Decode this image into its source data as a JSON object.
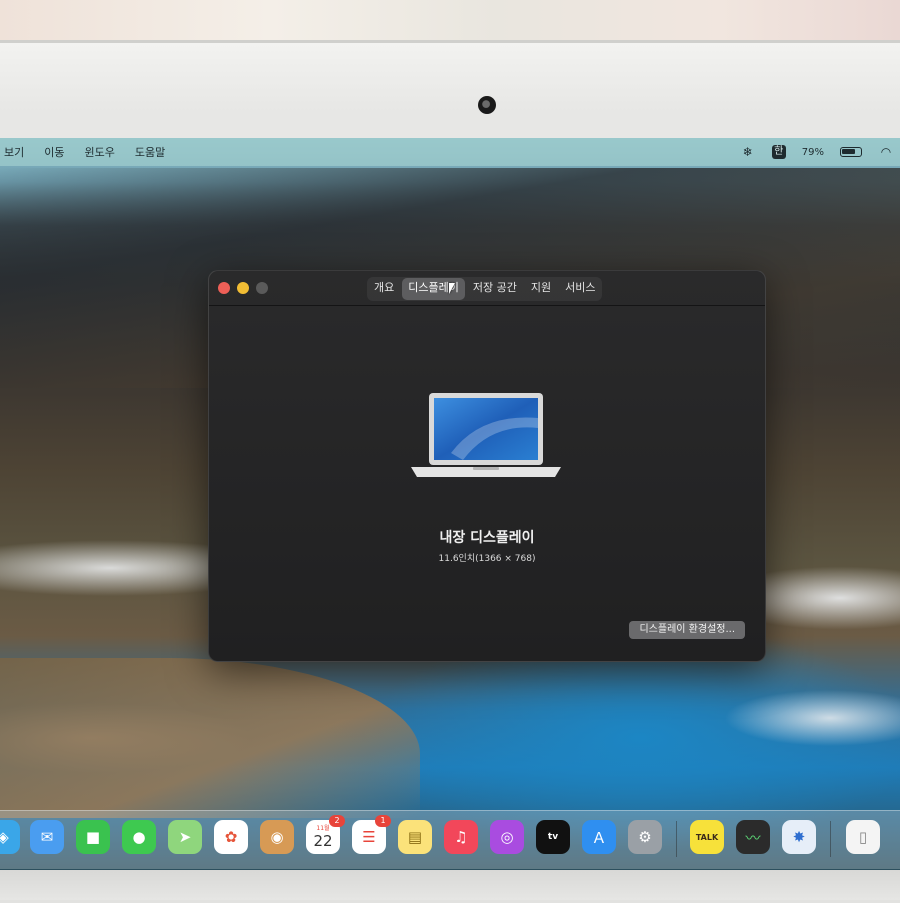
{
  "menubar": {
    "items": [
      "보기",
      "이동",
      "윈도우",
      "도움말"
    ],
    "status": {
      "hangul_label": "한",
      "battery_percent": "79%",
      "battery_level": 0.79
    }
  },
  "about_window": {
    "tabs": [
      "개요",
      "디스플레이",
      "저장 공간",
      "지원",
      "서비스"
    ],
    "active_tab": "디스플레이",
    "display_name": "내장 디스플레이",
    "display_spec": "11.6인치(1366 × 768)",
    "prefs_button_label": "디스플레이 환경설정..."
  },
  "dock": {
    "apps": [
      {
        "name": "safari",
        "icon": "compass-icon"
      },
      {
        "name": "mail",
        "icon": "envelope-icon"
      },
      {
        "name": "facetime",
        "icon": "video-camera-icon"
      },
      {
        "name": "messages",
        "icon": "speech-bubble-icon"
      },
      {
        "name": "maps",
        "icon": "map-icon"
      },
      {
        "name": "photos",
        "icon": "flower-icon"
      },
      {
        "name": "contacts",
        "icon": "contacts-icon"
      },
      {
        "name": "calendar",
        "icon": "calendar-icon",
        "month": "11월",
        "day": "22",
        "badge": "2"
      },
      {
        "name": "reminders",
        "icon": "checklist-icon",
        "badge": "1"
      },
      {
        "name": "notes",
        "icon": "notepad-icon"
      },
      {
        "name": "music",
        "icon": "music-note-icon"
      },
      {
        "name": "podcasts",
        "icon": "podcast-icon"
      },
      {
        "name": "tv",
        "icon": "tv-icon",
        "label": "tv"
      },
      {
        "name": "app-store",
        "icon": "app-store-icon"
      },
      {
        "name": "system-preferences",
        "icon": "gear-icon"
      },
      {
        "name": "kakaotalk",
        "icon": "talk-icon",
        "label": "TALK"
      },
      {
        "name": "activity-monitor",
        "icon": "monitor-icon"
      },
      {
        "name": "utility",
        "icon": "gear-blue-icon"
      },
      {
        "name": "preview",
        "icon": "document-icon"
      }
    ]
  },
  "colors": {
    "close": "#ee5f57",
    "minimize": "#f2bd34",
    "badge": "#e8443a"
  }
}
